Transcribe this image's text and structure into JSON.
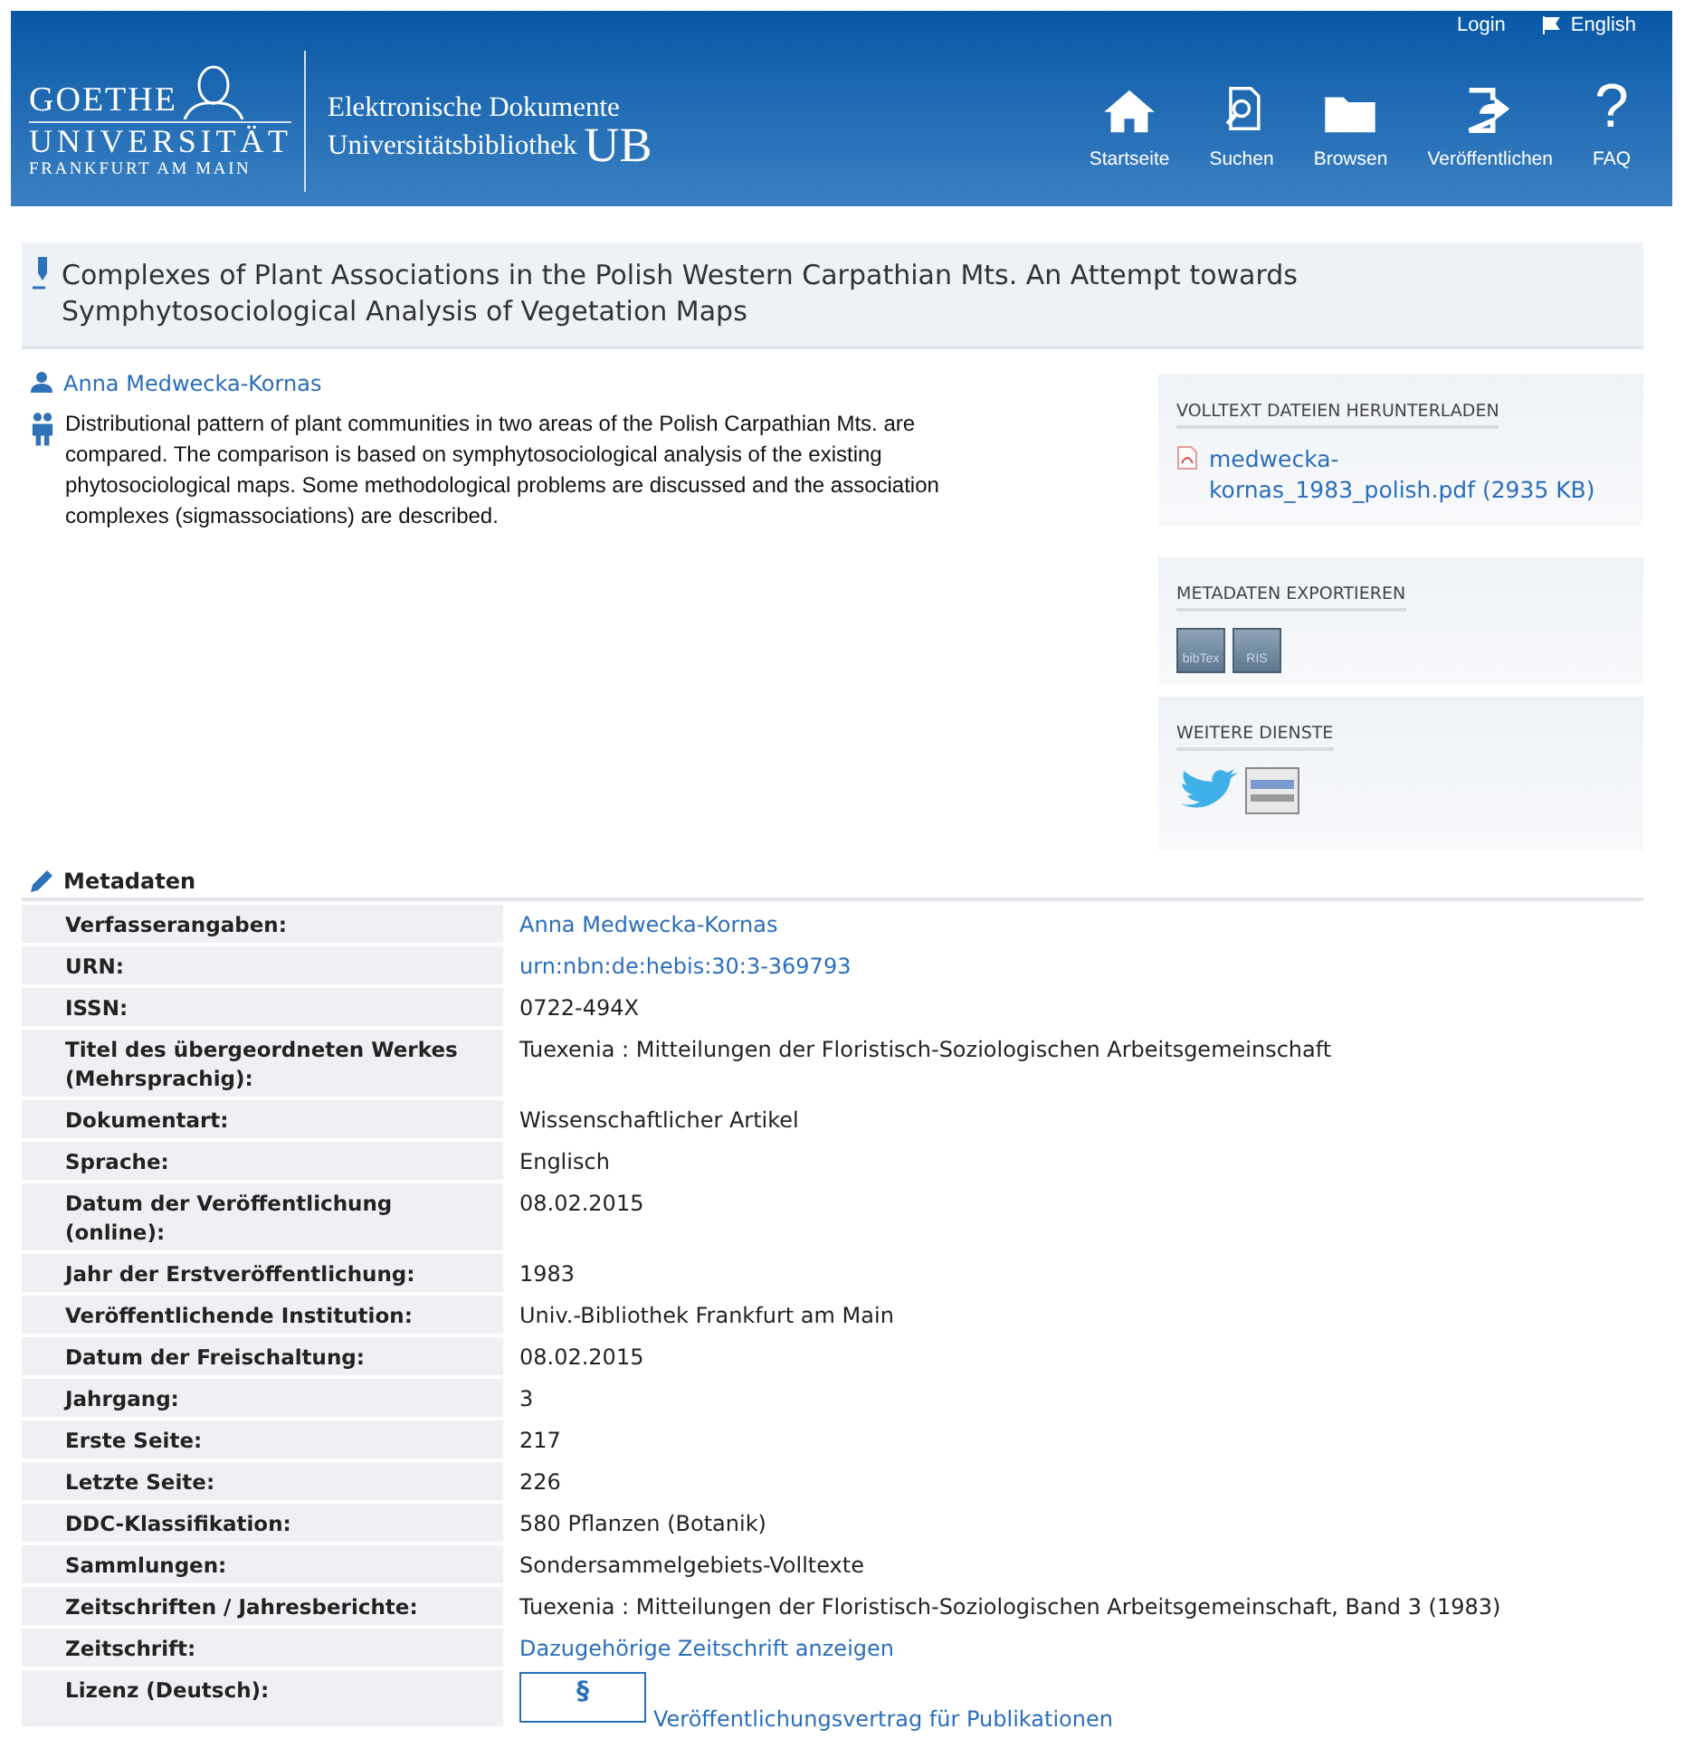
{
  "header": {
    "top_links": [
      {
        "label": "Login",
        "kind": "plain"
      },
      {
        "label": "English",
        "kind": "flag"
      }
    ],
    "logo": {
      "line1": "GOETHE",
      "line2": "UNIVERSITÄT",
      "line3": "FRANKFURT AM MAIN"
    },
    "subtitle": {
      "line1": "Elektronische Dokumente",
      "line2": "Universitätsbibliothek",
      "mark": "UB"
    },
    "nav": [
      {
        "label": "Startseite",
        "kind": "home"
      },
      {
        "label": "Suchen",
        "kind": "search"
      },
      {
        "label": "Browsen",
        "kind": "folder"
      },
      {
        "label": "Veröffentlichen",
        "kind": "export"
      },
      {
        "label": "FAQ",
        "kind": "glyph",
        "glyph": "?"
      }
    ]
  },
  "title": "Complexes of Plant Associations in the Polish Western Carpathian Mts. An Attempt towards Symphytosociological Analysis of Vegetation Maps",
  "author": "Anna Medwecka-Kornas",
  "abstract": "Distributional pattern of plant communities in two areas of the Polish Carpathian Mts. are compared. The comparison is based on symphytosociological analysis of the existing phytosociological maps. Some methodological problems are discussed and the association complexes (sigmassociations) are described.",
  "sidebar": [
    {
      "heading": "VOLLTEXT DATEIEN HERUNTERLADEN",
      "kind": "file",
      "file": "medwecka-kornas_1983_polish.pdf",
      "size": "(2935 KB)"
    },
    {
      "heading": "METADATEN EXPORTIEREN",
      "kind": "export",
      "buttons": [
        "bibTex",
        "RIS"
      ]
    },
    {
      "heading": "WEITERE DIENSTE",
      "kind": "services"
    }
  ],
  "metadata": {
    "heading": "Metadaten",
    "rows": [
      {
        "label": "Verfasserangaben:",
        "value": "Anna Medwecka-Kornas",
        "kind": "link"
      },
      {
        "label": "URN:",
        "value": "urn:nbn:de:hebis:30:3-369793",
        "kind": "link"
      },
      {
        "label": "ISSN:",
        "value": "0722-494X",
        "kind": "text"
      },
      {
        "label": "Titel des übergeordneten Werkes (Mehrsprachig):",
        "value": "Tuexenia : Mitteilungen der Floristisch-Soziologischen Arbeitsgemeinschaft",
        "kind": "text"
      },
      {
        "label": "Dokumentart:",
        "value": "Wissenschaftlicher Artikel",
        "kind": "text"
      },
      {
        "label": "Sprache:",
        "value": "Englisch",
        "kind": "text"
      },
      {
        "label": "Datum der Veröffentlichung (online):",
        "value": "08.02.2015",
        "kind": "text"
      },
      {
        "label": "Jahr der Erstveröffentlichung:",
        "value": "1983",
        "kind": "text"
      },
      {
        "label": "Veröffentlichende Institution:",
        "value": "Univ.-Bibliothek Frankfurt am Main",
        "kind": "text"
      },
      {
        "label": "Datum der Freischaltung:",
        "value": "08.02.2015",
        "kind": "text"
      },
      {
        "label": "Jahrgang:",
        "value": "3",
        "kind": "text"
      },
      {
        "label": "Erste Seite:",
        "value": "217",
        "kind": "text"
      },
      {
        "label": "Letzte Seite:",
        "value": "226",
        "kind": "text"
      },
      {
        "label": "DDC-Klassifikation:",
        "value": "580 Pflanzen (Botanik)",
        "kind": "text"
      },
      {
        "label": "Sammlungen:",
        "value": "Sondersammelgebiets-Volltexte",
        "kind": "text"
      },
      {
        "label": "Zeitschriften / Jahresberichte:",
        "value": "Tuexenia : Mitteilungen der Floristisch-Soziologischen Arbeitsgemeinschaft, Band 3 (1983)",
        "kind": "text"
      },
      {
        "label": "Zeitschrift:",
        "value": "Dazugehörige Zeitschrift anzeigen",
        "kind": "link"
      },
      {
        "label": "Lizenz (Deutsch):",
        "value": "Veröffentlichungsvertrag für Publikationen",
        "kind": "license",
        "badge": "§"
      }
    ]
  }
}
